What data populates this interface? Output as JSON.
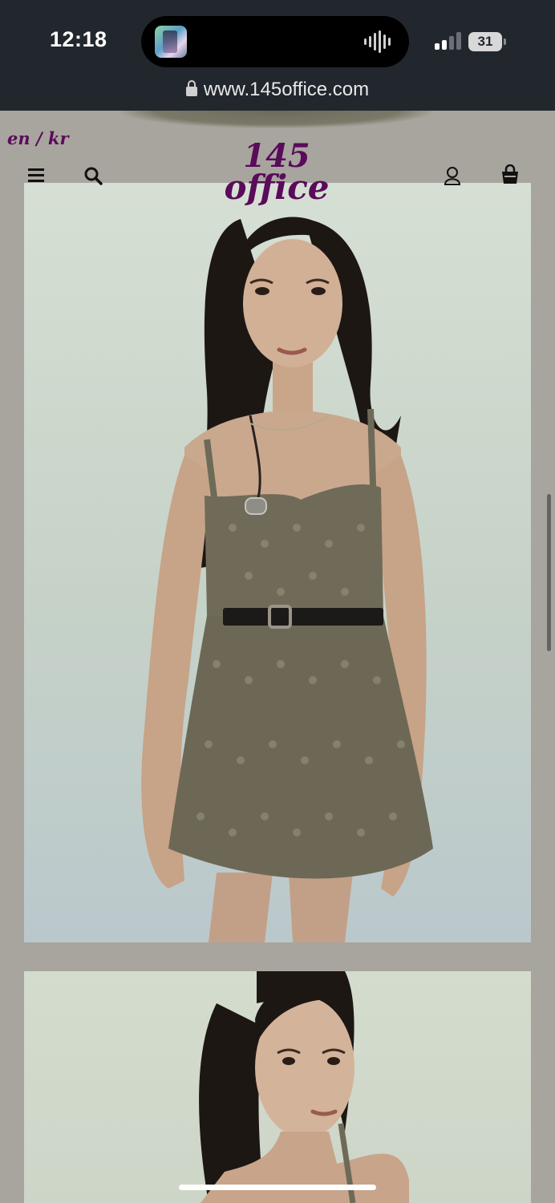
{
  "status_bar": {
    "time": "12:18",
    "battery": "31",
    "now_playing_icon": "album-art-thumbnail",
    "audio_icon": "waveform-icon"
  },
  "browser": {
    "url": "www.145office.com"
  },
  "header": {
    "lang_switch": "en / kr",
    "logo_line1": "145",
    "logo_line2": "office",
    "brand_color": "#5a0b5a",
    "icons": [
      "menu-icon",
      "search-icon",
      "account-icon",
      "bag-icon"
    ]
  },
  "gallery": {
    "images": [
      {
        "alt": "model in gray-green eyelet mini dress with black belt, full length"
      },
      {
        "alt": "model in gray-green eyelet dress, close-up portrait"
      }
    ]
  },
  "colors": {
    "page_background": "#a8a59e",
    "status_bar": "#22272e"
  }
}
